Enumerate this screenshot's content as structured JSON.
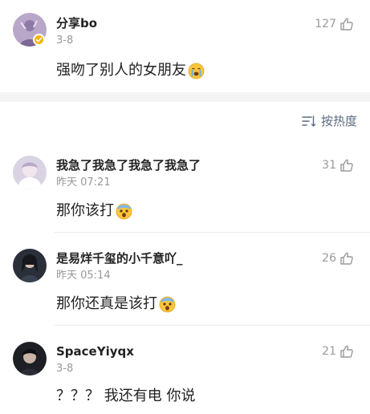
{
  "post": {
    "username": "分享bo",
    "time": "3-8",
    "text": "强吻了别人的女朋友",
    "like_count": "127",
    "emoji": "crying-face"
  },
  "sort": {
    "label": "按热度",
    "icon": "sort-lines-icon"
  },
  "comments": [
    {
      "username": "我急了我急了我急了我急了",
      "time": "昨天 07:21",
      "text": "那你该打",
      "like_count": "31",
      "emoji": "shocked-face"
    },
    {
      "username": "是易烊千玺的小千意吖_",
      "time": "昨天 05:14",
      "text": "那你还真是该打",
      "like_count": "26",
      "emoji": "shocked-face"
    },
    {
      "username": "SpaceYiyqx",
      "time": "3-8",
      "text": "？？？ 我还有电 你说",
      "like_count": "21",
      "emoji": ""
    }
  ],
  "colors": {
    "username": "#222222",
    "meta": "#999999",
    "sort_accent": "#5b6b82",
    "badge": "#f7b500",
    "separator": "#f4f4f4"
  }
}
